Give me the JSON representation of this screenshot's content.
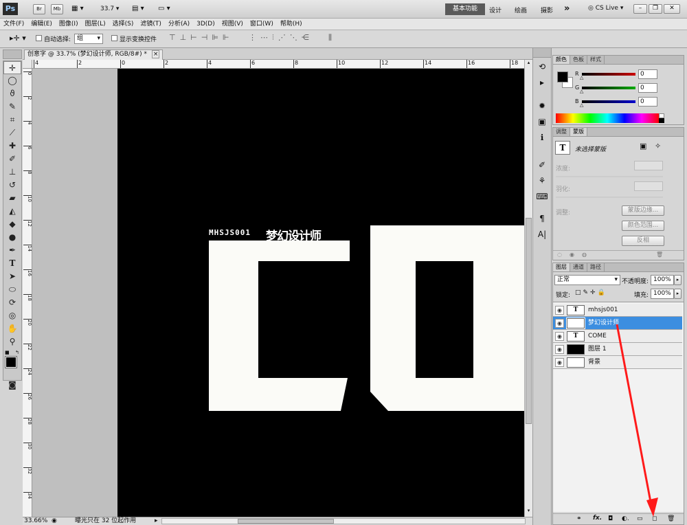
{
  "app": {
    "logo": "Ps",
    "zoom": "33.7",
    "workspaces": [
      "基本功能",
      "设计",
      "绘画",
      "摄影"
    ],
    "more": "»",
    "cslive": "CS Live"
  },
  "menu": [
    "文件(F)",
    "编辑(E)",
    "图像(I)",
    "图层(L)",
    "选择(S)",
    "滤镜(T)",
    "分析(A)",
    "3D(D)",
    "视图(V)",
    "窗口(W)",
    "帮助(H)"
  ],
  "options": {
    "auto_select_label": "自动选择:",
    "auto_select_value": "组",
    "show_transform_label": "显示变换控件"
  },
  "document": {
    "tab_title": "创意字 @ 33.7% (梦幻设计师, RGB/8#) *",
    "close": "×",
    "ruler_h": [
      "4",
      "2",
      "0",
      "2",
      "4",
      "6",
      "8",
      "10",
      "12",
      "14",
      "16",
      "18"
    ],
    "ruler_v": [
      "0",
      "2",
      "4",
      "6",
      "8",
      "10",
      "12",
      "14",
      "16",
      "18",
      "20",
      "22",
      "24",
      "26",
      "28",
      "30",
      "32",
      "34"
    ]
  },
  "canvas": {
    "small_text": "MHSJS001",
    "title_text": "梦幻设计师",
    "big_text": "CO"
  },
  "status": {
    "zoom": "33.66%",
    "info": "曝光只在 32 位起作用"
  },
  "color_panel": {
    "tabs": [
      "颜色",
      "色板",
      "样式"
    ],
    "channels": [
      {
        "label": "R",
        "value": "0",
        "color": "#cc0000"
      },
      {
        "label": "G",
        "value": "0",
        "color": "#00aa00"
      },
      {
        "label": "B",
        "value": "0",
        "color": "#0000cc"
      }
    ]
  },
  "mask_panel": {
    "tabs": [
      "调整",
      "蒙版"
    ],
    "mask_label": "未选择蒙版",
    "density_label": "浓度:",
    "feather_label": "羽化:",
    "refine_label": "调整:",
    "buttons": [
      "蒙版边缘...",
      "颜色范围...",
      "反相"
    ]
  },
  "layers_panel": {
    "tabs": [
      "图层",
      "通道",
      "路径"
    ],
    "blend_mode": "正常",
    "opacity_label": "不透明度:",
    "opacity_value": "100%",
    "lock_label": "锁定:",
    "fill_label": "填充:",
    "fill_value": "100%",
    "layers": [
      {
        "name": "mhsjs001",
        "thumb": "T",
        "selected": false
      },
      {
        "name": "梦幻设计师",
        "thumb": "T",
        "selected": true
      },
      {
        "name": "COME",
        "thumb": "T",
        "selected": false
      },
      {
        "name": "图层 1",
        "thumb": "",
        "selected": false
      },
      {
        "name": "背景",
        "thumb": "",
        "selected": false
      }
    ]
  },
  "annotation_color": "#ff1a1a"
}
